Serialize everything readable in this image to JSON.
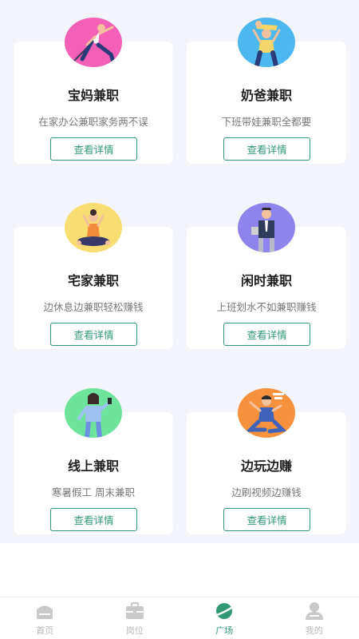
{
  "cards": [
    {
      "title": "宝妈兼职",
      "desc": "在家办公兼职家务两不误",
      "button": "查看详情",
      "illustration": "woman-martial-arts",
      "bg_color": "#f45fb7"
    },
    {
      "title": "奶爸兼职",
      "desc": "下班带娃兼职全都要",
      "button": "查看详情",
      "illustration": "man-holding-baby",
      "bg_color": "#4cb8ef"
    },
    {
      "title": "宅家兼职",
      "desc": "边休息边兼职轻松赚钱",
      "button": "查看详情",
      "illustration": "woman-yoga",
      "bg_color": "#f7dd72"
    },
    {
      "title": "闲时兼职",
      "desc": "上班划水不如兼职赚钱",
      "button": "查看详情",
      "illustration": "man-in-suit",
      "bg_color": "#8f84ec"
    },
    {
      "title": "线上兼职",
      "desc": "寒暑假工 周末兼职",
      "button": "查看详情",
      "illustration": "student-with-phone",
      "bg_color": "#6de39c"
    },
    {
      "title": "边玩边赚",
      "desc": "边刷视频边赚钱",
      "button": "查看详情",
      "illustration": "man-gaming",
      "bg_color": "#f7913e"
    }
  ],
  "tabs": [
    {
      "label": "首页",
      "icon": "home-icon",
      "active": false
    },
    {
      "label": "岗位",
      "icon": "briefcase-icon",
      "active": false
    },
    {
      "label": "广场",
      "icon": "planet-icon",
      "active": true
    },
    {
      "label": "我的",
      "icon": "user-icon",
      "active": false
    }
  ],
  "colors": {
    "accent": "#2f9a73",
    "inactive": "#b9b9b9",
    "page_bg": "#f4f5fa"
  }
}
